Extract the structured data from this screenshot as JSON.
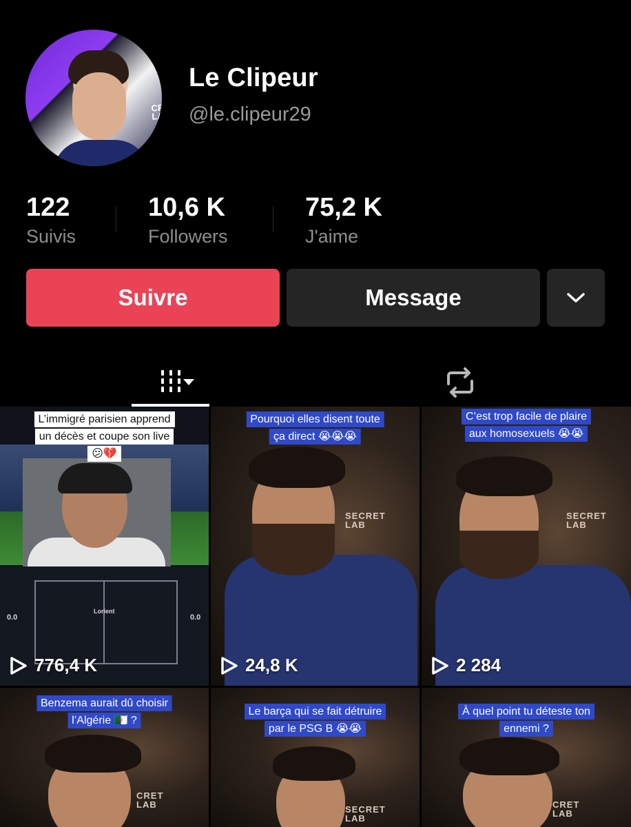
{
  "profile": {
    "display_name": "Le Clipeur",
    "handle": "@le.clipeur29",
    "avatar_brand": "CRET\nLAB"
  },
  "stats": [
    {
      "value": "122",
      "label": "Suivis"
    },
    {
      "value": "10,6 K",
      "label": "Followers"
    },
    {
      "value": "75,2 K",
      "label": "J'aime"
    }
  ],
  "actions": {
    "follow_label": "Suivre",
    "message_label": "Message",
    "more_icon": "chevron-down-icon"
  },
  "tabs": {
    "videos_icon": "grid-columns-icon",
    "reposts_icon": "repost-icon"
  },
  "colors": {
    "follow": "#ea4356",
    "secondary_button": "#252525",
    "caption_blue": "#2f49c9",
    "muted_text": "#8d8d8d"
  },
  "videos": [
    {
      "caption": [
        "L’immigré parisien apprend",
        "un décès et coupe son live",
        "😕💔"
      ],
      "views": "776,4 K",
      "score_left": "0.0",
      "score_right": "0.0",
      "team": "Lorient"
    },
    {
      "caption": [
        "Pourquoi elles disent toute",
        "ça direct 😭😭😭"
      ],
      "views": "24,8 K",
      "brand": "SECRET\nLAB"
    },
    {
      "caption": [
        "C’est trop facile de plaire",
        "aux homosexuels 😭😭"
      ],
      "views": "2 284",
      "brand": "SECRET\nLAB"
    },
    {
      "caption": [
        "Benzema aurait dû choisir",
        "l’Algérie 🇩🇿 ?"
      ],
      "brand": "CRET\nLAB"
    },
    {
      "caption": [
        "Le barça qui se fait détruire",
        "par le PSG B 😭😭"
      ],
      "brand": "SECRET\nLAB"
    },
    {
      "caption": [
        "À quel point tu déteste ton",
        "ennemi ?"
      ],
      "brand": "CRET\nLAB"
    }
  ]
}
